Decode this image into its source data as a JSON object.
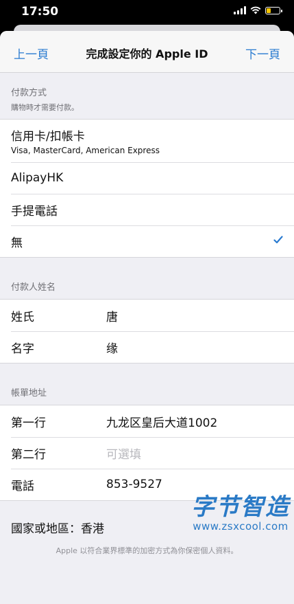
{
  "status_bar": {
    "time": "17:50"
  },
  "nav": {
    "back_label": "上一頁",
    "title": "完成設定你的 Apple ID",
    "next_label": "下一頁"
  },
  "payment": {
    "header": "付款方式",
    "subheader": "購物時才需要付款。",
    "options": [
      {
        "label": "信用卡/扣帳卡",
        "detail": "Visa, MasterCard, American Express"
      },
      {
        "label": "AlipayHK"
      },
      {
        "label": "手提電話"
      },
      {
        "label": "無",
        "selected": true
      }
    ]
  },
  "payer": {
    "header": "付款人姓名",
    "last_name_label": "姓氏",
    "last_name_value": "唐",
    "first_name_label": "名字",
    "first_name_value": "缘"
  },
  "billing": {
    "header": "帳單地址",
    "line1_label": "第一行",
    "line1_value": "九龙区皇后大道1002",
    "line2_label": "第二行",
    "line2_placeholder": "可選填",
    "phone_label": "電話",
    "phone_value": "853-9527",
    "country_text": "國家或地區：香港"
  },
  "watermark": {
    "main": "字节智造",
    "url": "www.zsxcool.com"
  },
  "footer": "Apple 以符合業界標準的加密方式為你保密個人資料。",
  "colors": {
    "accent": "#2a7bd0",
    "background": "#efeff4"
  }
}
